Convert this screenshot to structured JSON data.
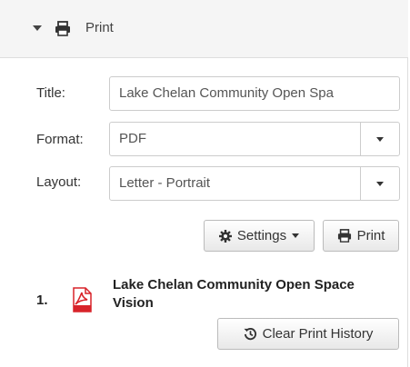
{
  "panel": {
    "header_title": "Print"
  },
  "form": {
    "title_label": "Title:",
    "title_value": "Lake Chelan Community Open Spa",
    "format_label": "Format:",
    "format_value": "PDF",
    "layout_label": "Layout:",
    "layout_value": "Letter - Portrait"
  },
  "buttons": {
    "settings_label": "Settings",
    "print_label": "Print",
    "clear_history_label": "Clear Print History"
  },
  "history": {
    "items": [
      {
        "number": "1.",
        "title": "Lake Chelan Community Open Space Vision",
        "icon": "pdf-file-icon"
      }
    ]
  },
  "icons": {
    "header": [
      "caret-down-icon",
      "printer-icon"
    ],
    "settings": "gear-icon",
    "print": "printer-icon",
    "clear_history": "history-icon"
  },
  "colors": {
    "header_bg": "#f5f5f5",
    "border": "#cccccc",
    "pdf_red": "#d8232a"
  }
}
